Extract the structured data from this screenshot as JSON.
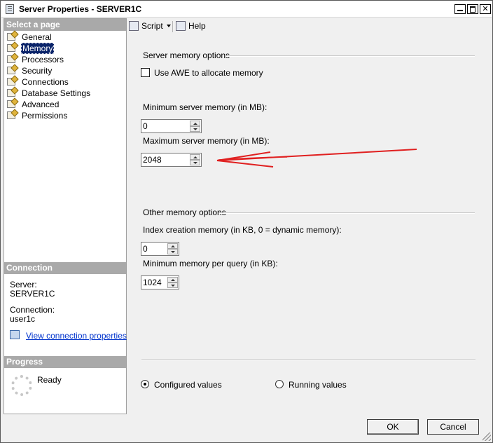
{
  "window": {
    "title": "Server Properties - SERVER1C",
    "minimize": "_",
    "maximize": "□",
    "close": "✕"
  },
  "sidebar": {
    "select_page_header": "Select a page",
    "items": [
      {
        "label": "General",
        "icon": "page-icon",
        "selected": false
      },
      {
        "label": "Memory",
        "icon": "page-icon",
        "selected": true
      },
      {
        "label": "Processors",
        "icon": "page-icon",
        "selected": false
      },
      {
        "label": "Security",
        "icon": "page-icon",
        "selected": false
      },
      {
        "label": "Connections",
        "icon": "page-icon",
        "selected": false
      },
      {
        "label": "Database Settings",
        "icon": "page-icon",
        "selected": false
      },
      {
        "label": "Advanced",
        "icon": "page-icon",
        "selected": false
      },
      {
        "label": "Permissions",
        "icon": "page-icon",
        "selected": false
      }
    ],
    "connection_header": "Connection",
    "server_label": "Server:",
    "server_value": "SERVER1C",
    "connection_label": "Connection:",
    "connection_value": "user1c",
    "view_connection_link": "View connection properties",
    "progress_header": "Progress",
    "progress_status": "Ready"
  },
  "toolbar": {
    "script_label": "Script",
    "help_label": "Help"
  },
  "memory": {
    "server_memory_group": "Server memory options",
    "use_awe_label": "Use AWE to allocate memory",
    "use_awe_checked": false,
    "min_server_memory_label": "Minimum server memory (in MB):",
    "min_server_memory_value": "0",
    "max_server_memory_label": "Maximum server memory (in MB):",
    "max_server_memory_value": "2048",
    "other_memory_group": "Other memory options",
    "index_creation_label": "Index creation memory (in KB, 0 = dynamic memory):",
    "index_creation_value": "0",
    "min_query_memory_label": "Minimum memory per query (in KB):",
    "min_query_memory_value": "1024",
    "configured_values_label": "Configured values",
    "running_values_label": "Running values",
    "selected_mode": "configured"
  },
  "footer": {
    "ok_label": "OK",
    "cancel_label": "Cancel"
  },
  "annotation": {
    "color": "#e02020"
  }
}
